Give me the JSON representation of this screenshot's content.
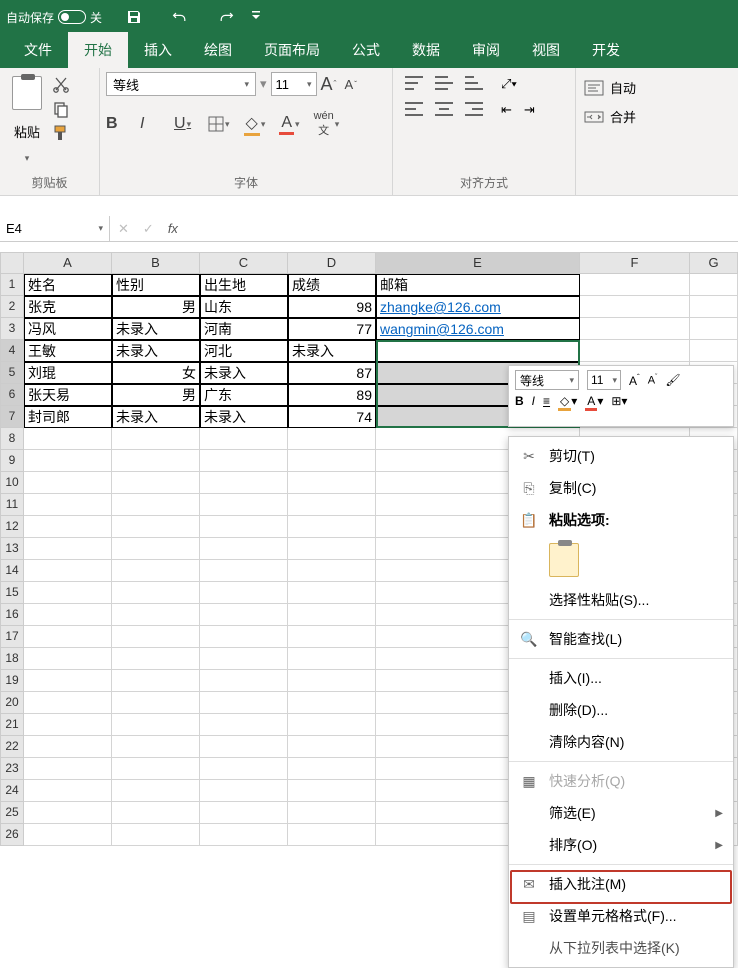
{
  "title_bar": {
    "autosave_label": "自动保存",
    "autosave_state": "关"
  },
  "tabs": {
    "file": "文件",
    "home": "开始",
    "insert": "插入",
    "draw": "绘图",
    "page_layout": "页面布局",
    "formulas": "公式",
    "data": "数据",
    "review": "审阅",
    "view": "视图",
    "dev": "开发"
  },
  "ribbon": {
    "clipboard_group": "剪贴板",
    "paste": "粘贴",
    "font_group": "字体",
    "font_name": "等线",
    "font_size": "11",
    "alignment_group": "对齐方式",
    "autosave_btn": "自动",
    "merge_btn": "合并"
  },
  "formula_bar": {
    "name_box": "E4",
    "fx": "fx"
  },
  "columns": [
    "A",
    "B",
    "C",
    "D",
    "E",
    "F",
    "G"
  ],
  "rows_shown": 26,
  "table": {
    "header": {
      "A": "姓名",
      "B": "性别",
      "C": "出生地",
      "D": "成绩",
      "E": "邮箱"
    },
    "rows": [
      {
        "A": "张克",
        "B": "男",
        "C": "山东",
        "D": "98",
        "E": "zhangke@126.com"
      },
      {
        "A": "冯风",
        "B": "未录入",
        "C": "河南",
        "D": "77",
        "E": "wangmin@126.com"
      },
      {
        "A": "王敏",
        "B": "未录入",
        "C": "河北",
        "D": "未录入",
        "E": ""
      },
      {
        "A": "刘琨",
        "B": "女",
        "C": "未录入",
        "D": "87",
        "E": ""
      },
      {
        "A": "张天易",
        "B": "男",
        "C": "广东",
        "D": "89",
        "E": ""
      },
      {
        "A": "封司郎",
        "B": "未录入",
        "C": "未录入",
        "D": "74",
        "E": ""
      }
    ]
  },
  "mini_toolbar": {
    "font_name": "等线",
    "font_size": "11"
  },
  "context_menu": {
    "cut": "剪切(T)",
    "copy": "复制(C)",
    "paste_options": "粘贴选项:",
    "paste_special": "选择性粘贴(S)...",
    "smart_lookup": "智能查找(L)",
    "insert": "插入(I)...",
    "delete": "删除(D)...",
    "clear_contents": "清除内容(N)",
    "quick_analysis": "快速分析(Q)",
    "filter": "筛选(E)",
    "sort": "排序(O)",
    "insert_comment": "插入批注(M)",
    "format_cells": "设置单元格格式(F)...",
    "pick_from_list": "从下拉列表中选择(K)"
  }
}
